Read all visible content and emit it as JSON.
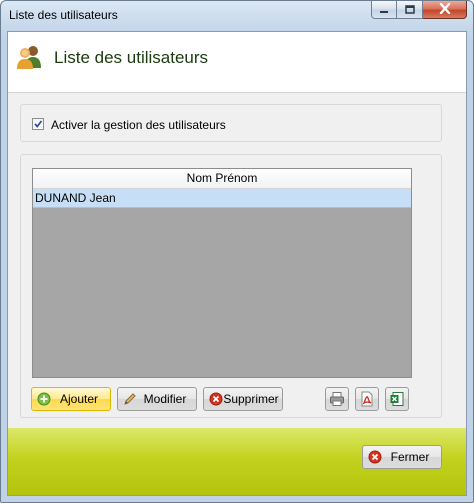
{
  "window": {
    "title": "Liste des utilisateurs"
  },
  "header": {
    "title": "Liste des utilisateurs",
    "icon": "users-icon"
  },
  "options": {
    "enable_label": "Activer la gestion des utilisateurs",
    "enable_checked": true
  },
  "table": {
    "columns": [
      "Nom Prénom"
    ],
    "rows": [
      [
        "DUNAND Jean"
      ]
    ]
  },
  "actions": {
    "add_label": "Ajouter",
    "edit_label": "Modifier",
    "delete_label": "Supprimer"
  },
  "footer": {
    "close_label": "Fermer"
  },
  "colors": {
    "footer_accent": "#c3d21e",
    "selection": "#c6dff7",
    "grid_background": "#a6a6a6"
  }
}
